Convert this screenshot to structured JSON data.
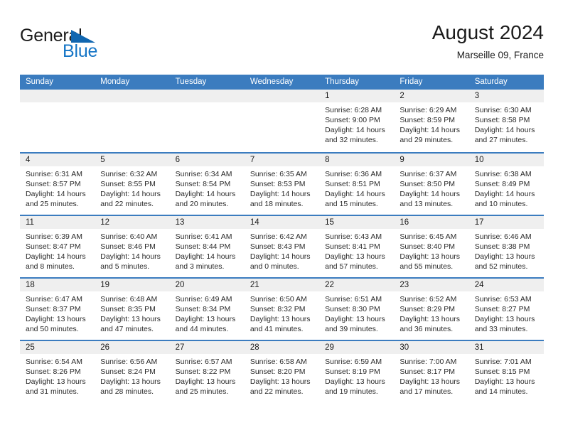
{
  "brand": {
    "line1": "General",
    "line2": "Blue",
    "triangle_icon": "triangle-icon",
    "color_dark": "#1b1b1b",
    "color_blue": "#1575c6"
  },
  "header": {
    "title": "August 2024",
    "subtitle": "Marseille 09, France"
  },
  "theme": {
    "header_blue": "#3b7cbf",
    "day_strip_gray": "#efefef",
    "text": "#1b1b1b"
  },
  "calendar": {
    "weekday_headers": [
      "Sunday",
      "Monday",
      "Tuesday",
      "Wednesday",
      "Thursday",
      "Friday",
      "Saturday"
    ],
    "weeks": [
      [
        {
          "day": "",
          "empty": true
        },
        {
          "day": "",
          "empty": true
        },
        {
          "day": "",
          "empty": true
        },
        {
          "day": "",
          "empty": true
        },
        {
          "day": "1",
          "sunrise": "Sunrise: 6:28 AM",
          "sunset": "Sunset: 9:00 PM",
          "daylight": "Daylight: 14 hours and 32 minutes."
        },
        {
          "day": "2",
          "sunrise": "Sunrise: 6:29 AM",
          "sunset": "Sunset: 8:59 PM",
          "daylight": "Daylight: 14 hours and 29 minutes."
        },
        {
          "day": "3",
          "sunrise": "Sunrise: 6:30 AM",
          "sunset": "Sunset: 8:58 PM",
          "daylight": "Daylight: 14 hours and 27 minutes."
        }
      ],
      [
        {
          "day": "4",
          "sunrise": "Sunrise: 6:31 AM",
          "sunset": "Sunset: 8:57 PM",
          "daylight": "Daylight: 14 hours and 25 minutes."
        },
        {
          "day": "5",
          "sunrise": "Sunrise: 6:32 AM",
          "sunset": "Sunset: 8:55 PM",
          "daylight": "Daylight: 14 hours and 22 minutes."
        },
        {
          "day": "6",
          "sunrise": "Sunrise: 6:34 AM",
          "sunset": "Sunset: 8:54 PM",
          "daylight": "Daylight: 14 hours and 20 minutes."
        },
        {
          "day": "7",
          "sunrise": "Sunrise: 6:35 AM",
          "sunset": "Sunset: 8:53 PM",
          "daylight": "Daylight: 14 hours and 18 minutes."
        },
        {
          "day": "8",
          "sunrise": "Sunrise: 6:36 AM",
          "sunset": "Sunset: 8:51 PM",
          "daylight": "Daylight: 14 hours and 15 minutes."
        },
        {
          "day": "9",
          "sunrise": "Sunrise: 6:37 AM",
          "sunset": "Sunset: 8:50 PM",
          "daylight": "Daylight: 14 hours and 13 minutes."
        },
        {
          "day": "10",
          "sunrise": "Sunrise: 6:38 AM",
          "sunset": "Sunset: 8:49 PM",
          "daylight": "Daylight: 14 hours and 10 minutes."
        }
      ],
      [
        {
          "day": "11",
          "sunrise": "Sunrise: 6:39 AM",
          "sunset": "Sunset: 8:47 PM",
          "daylight": "Daylight: 14 hours and 8 minutes."
        },
        {
          "day": "12",
          "sunrise": "Sunrise: 6:40 AM",
          "sunset": "Sunset: 8:46 PM",
          "daylight": "Daylight: 14 hours and 5 minutes."
        },
        {
          "day": "13",
          "sunrise": "Sunrise: 6:41 AM",
          "sunset": "Sunset: 8:44 PM",
          "daylight": "Daylight: 14 hours and 3 minutes."
        },
        {
          "day": "14",
          "sunrise": "Sunrise: 6:42 AM",
          "sunset": "Sunset: 8:43 PM",
          "daylight": "Daylight: 14 hours and 0 minutes."
        },
        {
          "day": "15",
          "sunrise": "Sunrise: 6:43 AM",
          "sunset": "Sunset: 8:41 PM",
          "daylight": "Daylight: 13 hours and 57 minutes."
        },
        {
          "day": "16",
          "sunrise": "Sunrise: 6:45 AM",
          "sunset": "Sunset: 8:40 PM",
          "daylight": "Daylight: 13 hours and 55 minutes."
        },
        {
          "day": "17",
          "sunrise": "Sunrise: 6:46 AM",
          "sunset": "Sunset: 8:38 PM",
          "daylight": "Daylight: 13 hours and 52 minutes."
        }
      ],
      [
        {
          "day": "18",
          "sunrise": "Sunrise: 6:47 AM",
          "sunset": "Sunset: 8:37 PM",
          "daylight": "Daylight: 13 hours and 50 minutes."
        },
        {
          "day": "19",
          "sunrise": "Sunrise: 6:48 AM",
          "sunset": "Sunset: 8:35 PM",
          "daylight": "Daylight: 13 hours and 47 minutes."
        },
        {
          "day": "20",
          "sunrise": "Sunrise: 6:49 AM",
          "sunset": "Sunset: 8:34 PM",
          "daylight": "Daylight: 13 hours and 44 minutes."
        },
        {
          "day": "21",
          "sunrise": "Sunrise: 6:50 AM",
          "sunset": "Sunset: 8:32 PM",
          "daylight": "Daylight: 13 hours and 41 minutes."
        },
        {
          "day": "22",
          "sunrise": "Sunrise: 6:51 AM",
          "sunset": "Sunset: 8:30 PM",
          "daylight": "Daylight: 13 hours and 39 minutes."
        },
        {
          "day": "23",
          "sunrise": "Sunrise: 6:52 AM",
          "sunset": "Sunset: 8:29 PM",
          "daylight": "Daylight: 13 hours and 36 minutes."
        },
        {
          "day": "24",
          "sunrise": "Sunrise: 6:53 AM",
          "sunset": "Sunset: 8:27 PM",
          "daylight": "Daylight: 13 hours and 33 minutes."
        }
      ],
      [
        {
          "day": "25",
          "sunrise": "Sunrise: 6:54 AM",
          "sunset": "Sunset: 8:26 PM",
          "daylight": "Daylight: 13 hours and 31 minutes."
        },
        {
          "day": "26",
          "sunrise": "Sunrise: 6:56 AM",
          "sunset": "Sunset: 8:24 PM",
          "daylight": "Daylight: 13 hours and 28 minutes."
        },
        {
          "day": "27",
          "sunrise": "Sunrise: 6:57 AM",
          "sunset": "Sunset: 8:22 PM",
          "daylight": "Daylight: 13 hours and 25 minutes."
        },
        {
          "day": "28",
          "sunrise": "Sunrise: 6:58 AM",
          "sunset": "Sunset: 8:20 PM",
          "daylight": "Daylight: 13 hours and 22 minutes."
        },
        {
          "day": "29",
          "sunrise": "Sunrise: 6:59 AM",
          "sunset": "Sunset: 8:19 PM",
          "daylight": "Daylight: 13 hours and 19 minutes."
        },
        {
          "day": "30",
          "sunrise": "Sunrise: 7:00 AM",
          "sunset": "Sunset: 8:17 PM",
          "daylight": "Daylight: 13 hours and 17 minutes."
        },
        {
          "day": "31",
          "sunrise": "Sunrise: 7:01 AM",
          "sunset": "Sunset: 8:15 PM",
          "daylight": "Daylight: 13 hours and 14 minutes."
        }
      ]
    ]
  }
}
